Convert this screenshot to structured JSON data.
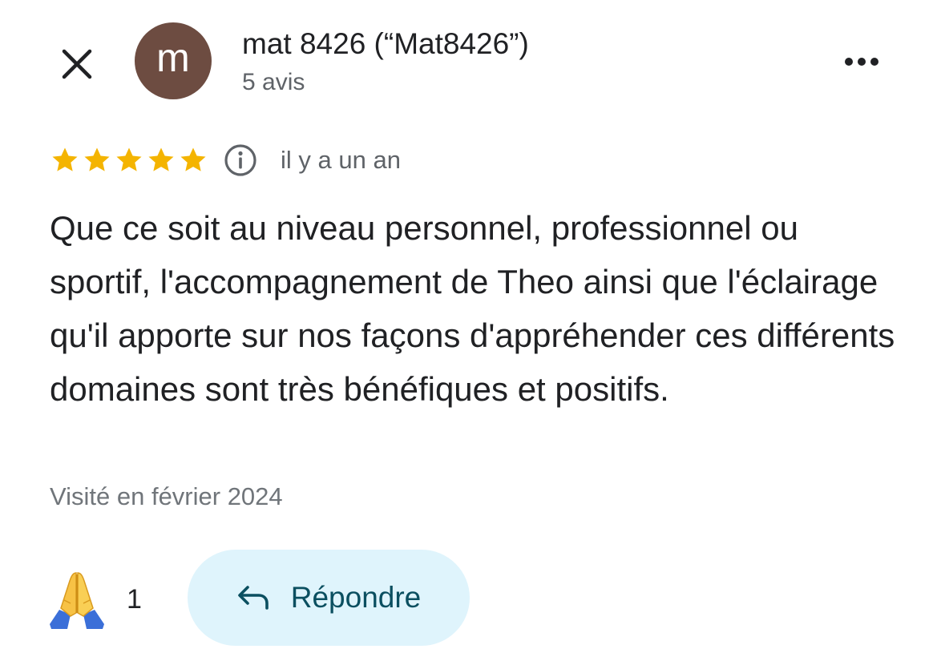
{
  "header": {
    "close_icon": "close-icon",
    "avatar_letter": "m",
    "avatar_color": "#6d4c41",
    "author_name": "mat 8426 (“Mat8426”)",
    "review_count": "5 avis",
    "more_icon": "more-horizontal-icon"
  },
  "review": {
    "rating": 5,
    "rating_max": 5,
    "star_color": "#f4b400",
    "info_icon": "info-icon",
    "date": "il y a un an",
    "text": "Que ce soit au niveau personnel, professionnel ou sportif, l'accompagnement de Theo ainsi que l'éclairage qu'il apporte sur nos façons d'appréhender ces différents domaines sont très bénéfiques et positifs.",
    "visited": "Visité en février 2024"
  },
  "actions": {
    "reaction_icon": "folded-hands-icon",
    "reaction_count": "1",
    "reply_icon": "reply-arrow-icon",
    "reply_label": "Répondre",
    "reply_bg_color": "#dff4fc"
  }
}
